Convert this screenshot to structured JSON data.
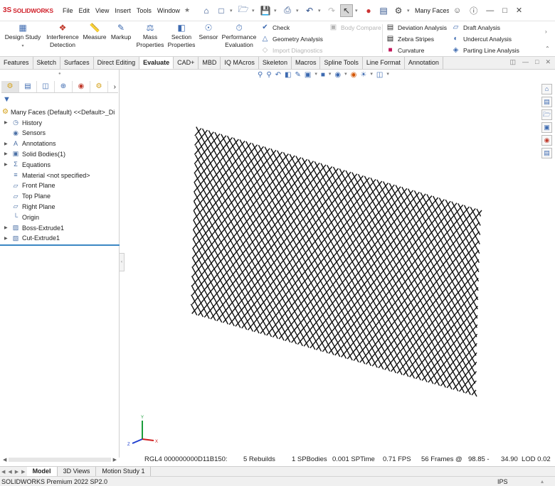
{
  "app": {
    "logo_mark": "3S",
    "logo_text": "SOLIDWORKS",
    "document_title": "Many Faces..."
  },
  "menu": [
    "File",
    "Edit",
    "View",
    "Insert",
    "Tools",
    "Window"
  ],
  "ribbon": {
    "design_study": "Design Study",
    "interference_detection_1": "Interference",
    "interference_detection_2": "Detection",
    "measure": "Measure",
    "markup": "Markup",
    "mass_properties_1": "Mass",
    "mass_properties_2": "Properties",
    "section_properties_1": "Section",
    "section_properties_2": "Properties",
    "sensor": "Sensor",
    "performance_evaluation_1": "Performance",
    "performance_evaluation_2": "Evaluation",
    "check": "Check",
    "geometry_analysis": "Geometry Analysis",
    "import_diagnostics": "Import Diagnostics",
    "body_compare": "Body Compare",
    "deviation_analysis": "Deviation Analysis",
    "zebra_stripes": "Zebra Stripes",
    "curvature": "Curvature",
    "draft_analysis": "Draft Analysis",
    "undercut_analysis": "Undercut Analysis",
    "parting_line_analysis": "Parting Line Analysis"
  },
  "tabs": [
    "Features",
    "Sketch",
    "Surfaces",
    "Direct Editing",
    "Evaluate",
    "CAD+",
    "MBD",
    "IQ MAcros",
    "Skeleton",
    "Macros",
    "Spline Tools",
    "Line Format",
    "Annotation"
  ],
  "active_tab": "Evaluate",
  "feature_tree": {
    "root": "Many Faces (Default) <<Default>_Di",
    "items": [
      {
        "label": "History",
        "icon": "history-icon",
        "expandable": true
      },
      {
        "label": "Sensors",
        "icon": "sensors-icon",
        "expandable": false
      },
      {
        "label": "Annotations",
        "icon": "annotations-icon",
        "expandable": true
      },
      {
        "label": "Solid Bodies(1)",
        "icon": "solid-bodies-icon",
        "expandable": true
      },
      {
        "label": "Equations",
        "icon": "equations-icon",
        "expandable": true
      },
      {
        "label": "Material <not specified>",
        "icon": "material-icon",
        "expandable": false
      },
      {
        "label": "Front Plane",
        "icon": "plane-icon",
        "expandable": false
      },
      {
        "label": "Top Plane",
        "icon": "plane-icon",
        "expandable": false
      },
      {
        "label": "Right Plane",
        "icon": "plane-icon",
        "expandable": false
      },
      {
        "label": "Origin",
        "icon": "origin-icon",
        "expandable": false
      },
      {
        "label": "Boss-Extrude1",
        "icon": "extrude-icon",
        "expandable": true
      },
      {
        "label": "Cut-Extrude1",
        "icon": "cut-extrude-icon",
        "expandable": true
      }
    ]
  },
  "triad": {
    "x": "X",
    "y": "Y",
    "z": "Z"
  },
  "status_line": {
    "rgl": "RGL4 000000000D11B150:",
    "rebuilds": "5 Rebuilds",
    "spbodies": "1 SPBodies",
    "sptime": "0.001 SPTime",
    "fps": "0.71 FPS",
    "frames": "56 Frames @",
    "frame_stats": "98.85 -",
    "lod_value": "34.90",
    "lod": "LOD 0.02"
  },
  "bottom_tabs": [
    "Model",
    "3D Views",
    "Motion Study 1"
  ],
  "statusbar": {
    "left": "SOLIDWORKS Premium 2022 SP2.0",
    "units": "IPS"
  },
  "colors": {
    "brand": "#d0202a",
    "accent": "#3b87c4"
  }
}
